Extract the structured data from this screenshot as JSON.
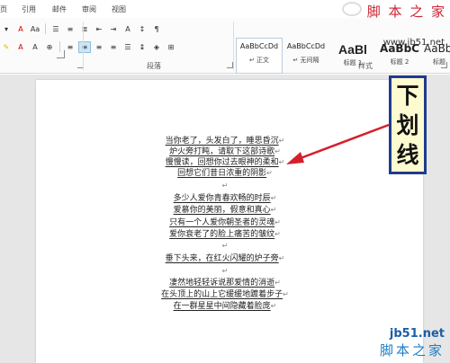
{
  "tabs": [
    "页",
    "引用",
    "邮件",
    "审阅",
    "视图"
  ],
  "watermark_top": {
    "title": "脚 本 之 家",
    "url": "www.jb51.net"
  },
  "ribbon": {
    "group_paragraph": "段落",
    "group_styles": "样式",
    "styles": [
      {
        "preview": "AaBbCcDd",
        "name": "↵ 正文"
      },
      {
        "preview": "AaBbCcDd",
        "name": "↵ 无间隔"
      },
      {
        "preview": "AaBl",
        "name": "标题 1"
      },
      {
        "preview": "AaBbC",
        "name": "标题 2"
      },
      {
        "preview": "AaBbC",
        "name": "标题"
      }
    ]
  },
  "poem": [
    "当你老了，头发白了，睡思昏沉",
    "炉火旁打盹，请取下这部诗歌",
    "慢慢读，回想你过去眼神的柔和",
    "回想它们昔日浓重的阴影",
    "",
    "多少人爱你青春欢畅的时辰",
    "爱慕你的美丽，假意和真心",
    "只有一个人爱你朝圣者的灵魂",
    "爱你衰老了的脸上痛苦的皱纹",
    "",
    "垂下头来，在红火闪耀的炉子旁",
    "",
    "凄然地轻轻诉说那爱情的消逝",
    "在头顶上的山上它缓缓地踱着步子",
    "在一群星星中间隐藏着脸庞"
  ],
  "paragraph_mark": "↵",
  "callout": [
    "下",
    "划",
    "线"
  ],
  "watermark_bottom": {
    "url": "jb51.net",
    "title": "脚本之家"
  },
  "colors": {
    "callout_border": "#1f3c8c",
    "callout_fill": "#fffbd0",
    "arrow": "#d4202a"
  }
}
